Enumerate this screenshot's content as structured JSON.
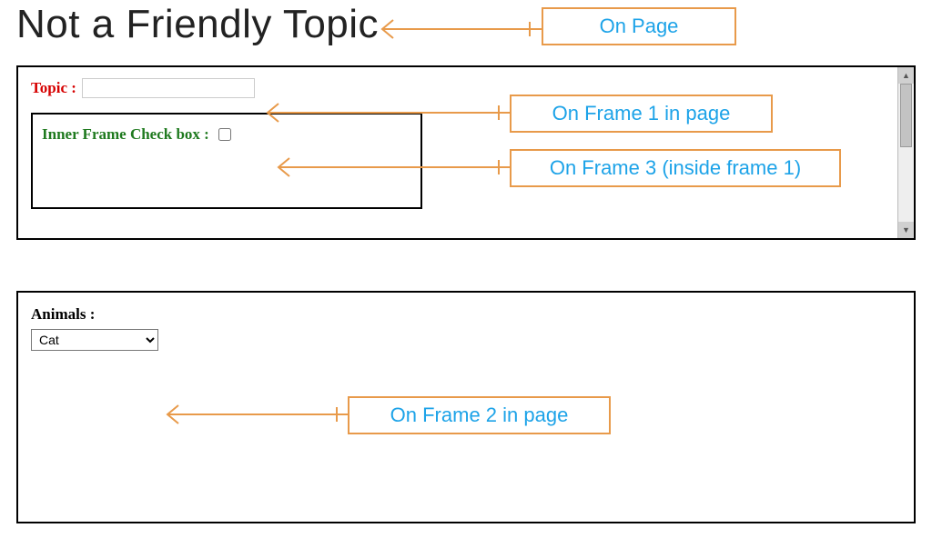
{
  "page": {
    "title": "Not a Friendly Topic"
  },
  "frame1": {
    "topic_label": "Topic :",
    "topic_value": ""
  },
  "frame3": {
    "checkbox_label": "Inner Frame Check box :",
    "checked": false
  },
  "frame2": {
    "animals_label": "Animals :",
    "selected": "Cat"
  },
  "callouts": {
    "on_page": "On Page",
    "on_frame1": "On Frame 1 in page",
    "on_frame3": "On Frame 3 (inside frame 1)",
    "on_frame2": "On Frame 2 in page"
  }
}
